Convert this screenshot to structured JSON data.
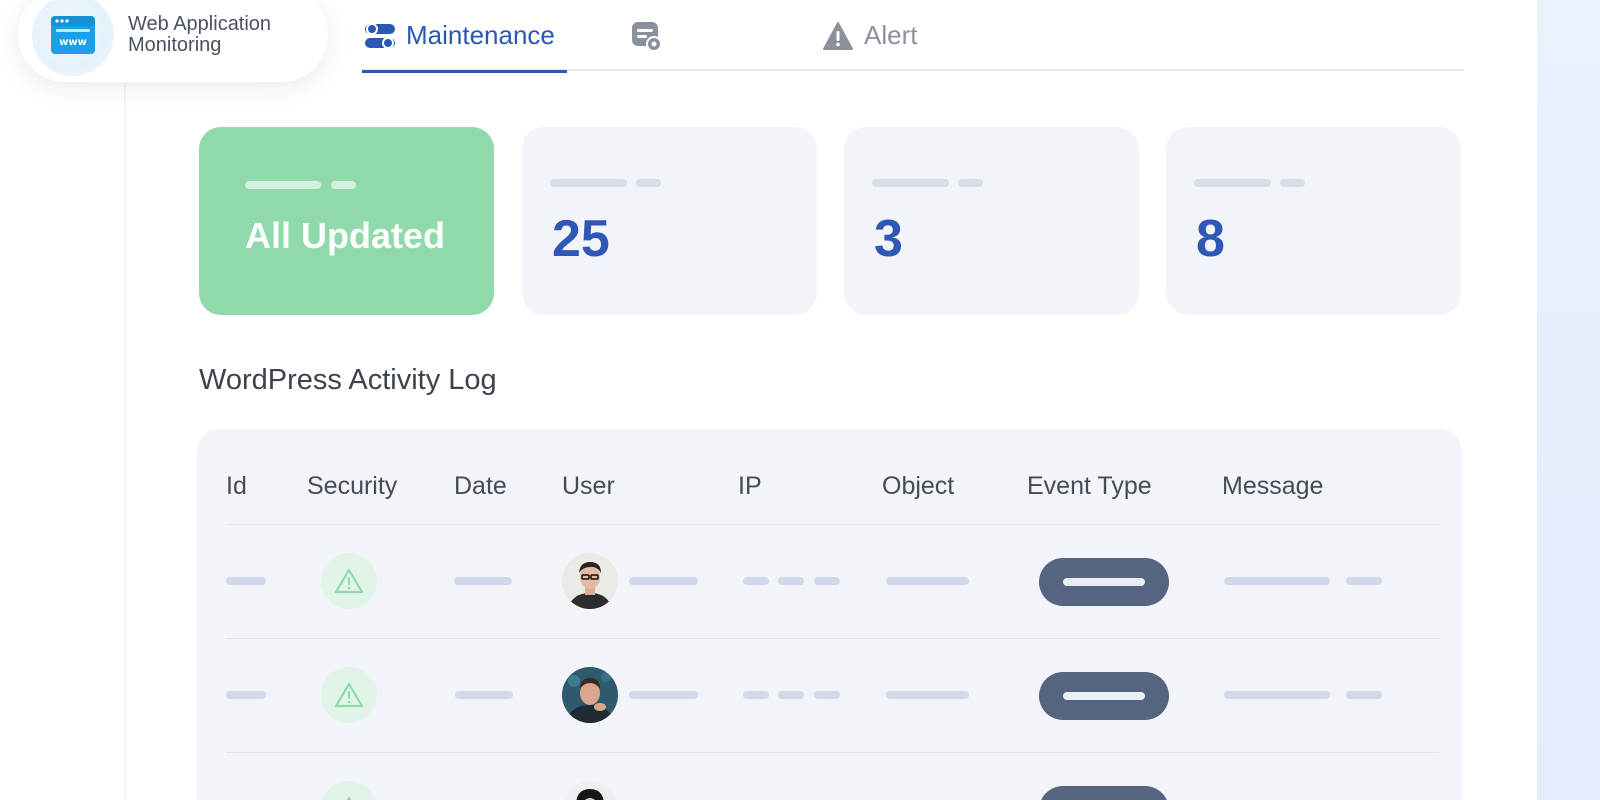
{
  "app": {
    "brand_line1": "Web Application",
    "brand_line2": "Monitoring",
    "brand_icon": "browser-www-icon"
  },
  "tabs": [
    {
      "label": "Maintenance",
      "icon": "toggle-settings-icon",
      "active": true
    },
    {
      "label": "",
      "icon": "server-settings-icon",
      "active": false
    },
    {
      "label": "Alert",
      "icon": "warning-triangle-icon",
      "active": false
    }
  ],
  "stats": [
    {
      "value": "All Updated",
      "variant": "success"
    },
    {
      "value": "25"
    },
    {
      "value": "3"
    },
    {
      "value": "8"
    }
  ],
  "activity_log": {
    "title": "WordPress Activity Log",
    "columns": [
      "Id",
      "Security",
      "Date",
      "User",
      "IP",
      "Object",
      "Event Type",
      "Message"
    ],
    "rows": [
      {
        "security_icon": "warning-triangle-outline-icon",
        "avatar": "user-avatar-1"
      },
      {
        "security_icon": "warning-triangle-outline-icon",
        "avatar": "user-avatar-2"
      },
      {
        "security_icon": "warning-triangle-outline-icon",
        "avatar": "user-avatar-3"
      }
    ]
  },
  "colors": {
    "accent": "#2a58b3",
    "success": "#8fd9aa",
    "card_bg": "#f2f4f9",
    "pill": "#56657f"
  }
}
